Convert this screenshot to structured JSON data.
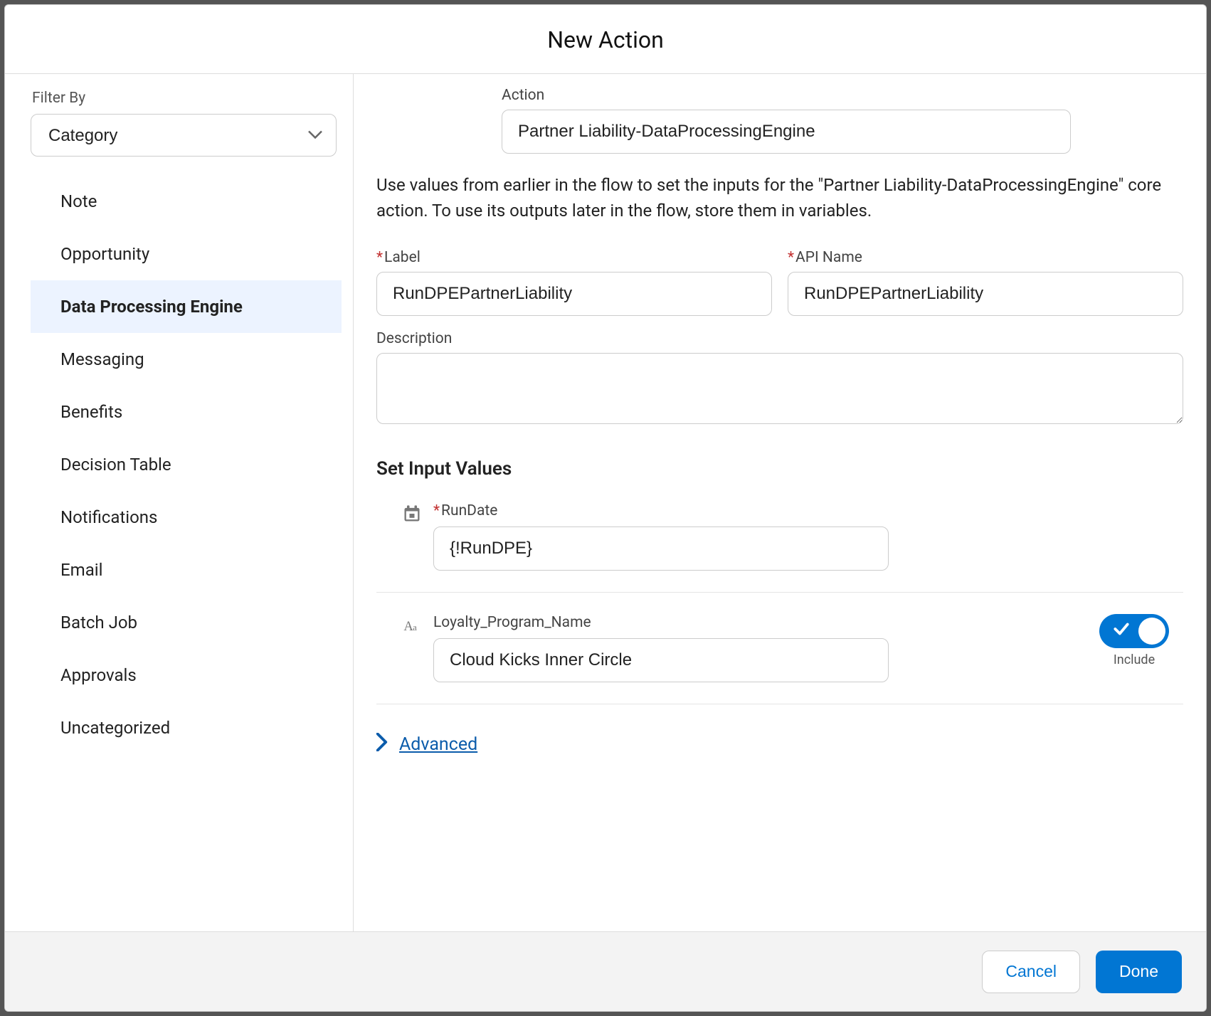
{
  "header": {
    "title": "New Action"
  },
  "sidebar": {
    "filter_label": "Filter By",
    "select_value": "Category",
    "items": [
      {
        "label": "Note",
        "active": false
      },
      {
        "label": "Opportunity",
        "active": false
      },
      {
        "label": "Data Processing Engine",
        "active": true
      },
      {
        "label": "Messaging",
        "active": false
      },
      {
        "label": "Benefits",
        "active": false
      },
      {
        "label": "Decision Table",
        "active": false
      },
      {
        "label": "Notifications",
        "active": false
      },
      {
        "label": "Email",
        "active": false
      },
      {
        "label": "Batch Job",
        "active": false
      },
      {
        "label": "Approvals",
        "active": false
      },
      {
        "label": "Uncategorized",
        "active": false
      }
    ]
  },
  "form": {
    "action_label": "Action",
    "action_value": "Partner Liability-DataProcessingEngine",
    "help_text": "Use values from earlier in the flow to set the inputs for the \"Partner Liability-DataProcessingEngine\" core action. To use its outputs later in the flow, store them in variables.",
    "label_caption": "Label",
    "label_value": "RunDPEPartnerLiability",
    "apiname_caption": "API Name",
    "apiname_value": "RunDPEPartnerLiability",
    "description_caption": "Description",
    "description_value": "",
    "section_title": "Set Input Values",
    "inputs": {
      "run_date": {
        "label": "RunDate",
        "value": "{!RunDPE}"
      },
      "program_name": {
        "label": "Loyalty_Program_Name",
        "value": "Cloud Kicks Inner Circle",
        "toggle_on": true,
        "toggle_label": "Include"
      }
    },
    "advanced_label": "Advanced"
  },
  "footer": {
    "cancel": "Cancel",
    "done": "Done"
  }
}
